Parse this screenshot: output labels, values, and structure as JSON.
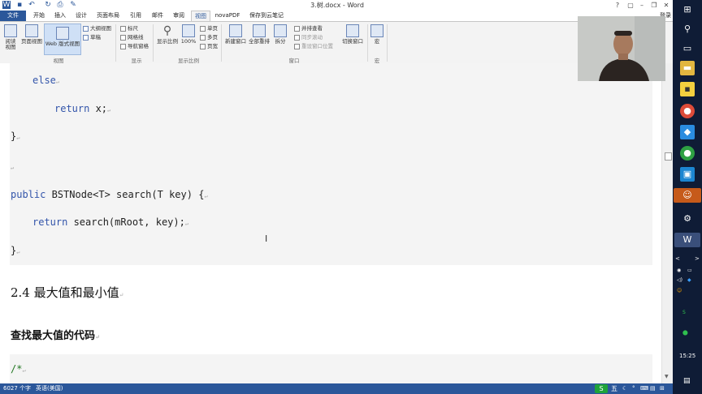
{
  "window": {
    "title": "3.树.docx - Word",
    "login": "登录",
    "controls": [
      "?",
      "▢",
      "–",
      "❐",
      "✕"
    ]
  },
  "quick_access": [
    "save-icon",
    "undo-icon",
    "redo-icon",
    "print-preview-icon",
    "format-painter-icon"
  ],
  "tabs": [
    "文件",
    "开始",
    "插入",
    "设计",
    "页面布局",
    "引用",
    "邮件",
    "审阅",
    "视图",
    "novaPDF",
    "保存到云笔记"
  ],
  "active_tab": "视图",
  "ribbon": {
    "views": {
      "read": "阅读\n视图",
      "print_layout": "页面视图",
      "web_layout": "Web 版式视图",
      "outline": "大纲视图",
      "draft": "草稿",
      "group": "视图"
    },
    "show": {
      "ruler": "标尺",
      "gridlines": "网格线",
      "nav_pane": "导航窗格",
      "group": "显示"
    },
    "zoom": {
      "zoom": "显示比例",
      "hundred": "100%",
      "one_page": "单页",
      "multi_page": "多页",
      "page_width": "页宽",
      "group": "显示比例"
    },
    "window": {
      "new_window": "新建窗口",
      "arrange_all": "全部重排",
      "split": "拆分",
      "side_by_side": "并排查看",
      "sync_scroll": "同步滚动",
      "reset_pos": "重设窗口位置",
      "switch": "切换窗口",
      "group": "窗口"
    },
    "macros": {
      "macros": "宏",
      "group": "宏"
    }
  },
  "document": {
    "code_lines": [
      {
        "kw": "else",
        "rest": ""
      },
      {
        "kw": "return",
        "rest": " x;"
      },
      {
        "kw": "",
        "rest": "}"
      },
      {
        "kw": "public",
        "rest": " BSTNode<T> search(T key) {"
      },
      {
        "kw": "return",
        "rest": " search(mRoot, key);"
      },
      {
        "kw": "",
        "rest": "}"
      }
    ],
    "para_mark": "↵",
    "heading_section": "2.4 最大值和最小值",
    "heading_sub": "查找最大值的代码",
    "comment_start": "/*"
  },
  "status": {
    "word_count": "6027 个字",
    "language": "英语(美国)"
  },
  "taskbar": {
    "time": "15:25",
    "ime": "五"
  },
  "colors": {
    "accent": "#2b579a",
    "code_bg": "#f4f4f4",
    "taskbar": "#0f1c36"
  }
}
